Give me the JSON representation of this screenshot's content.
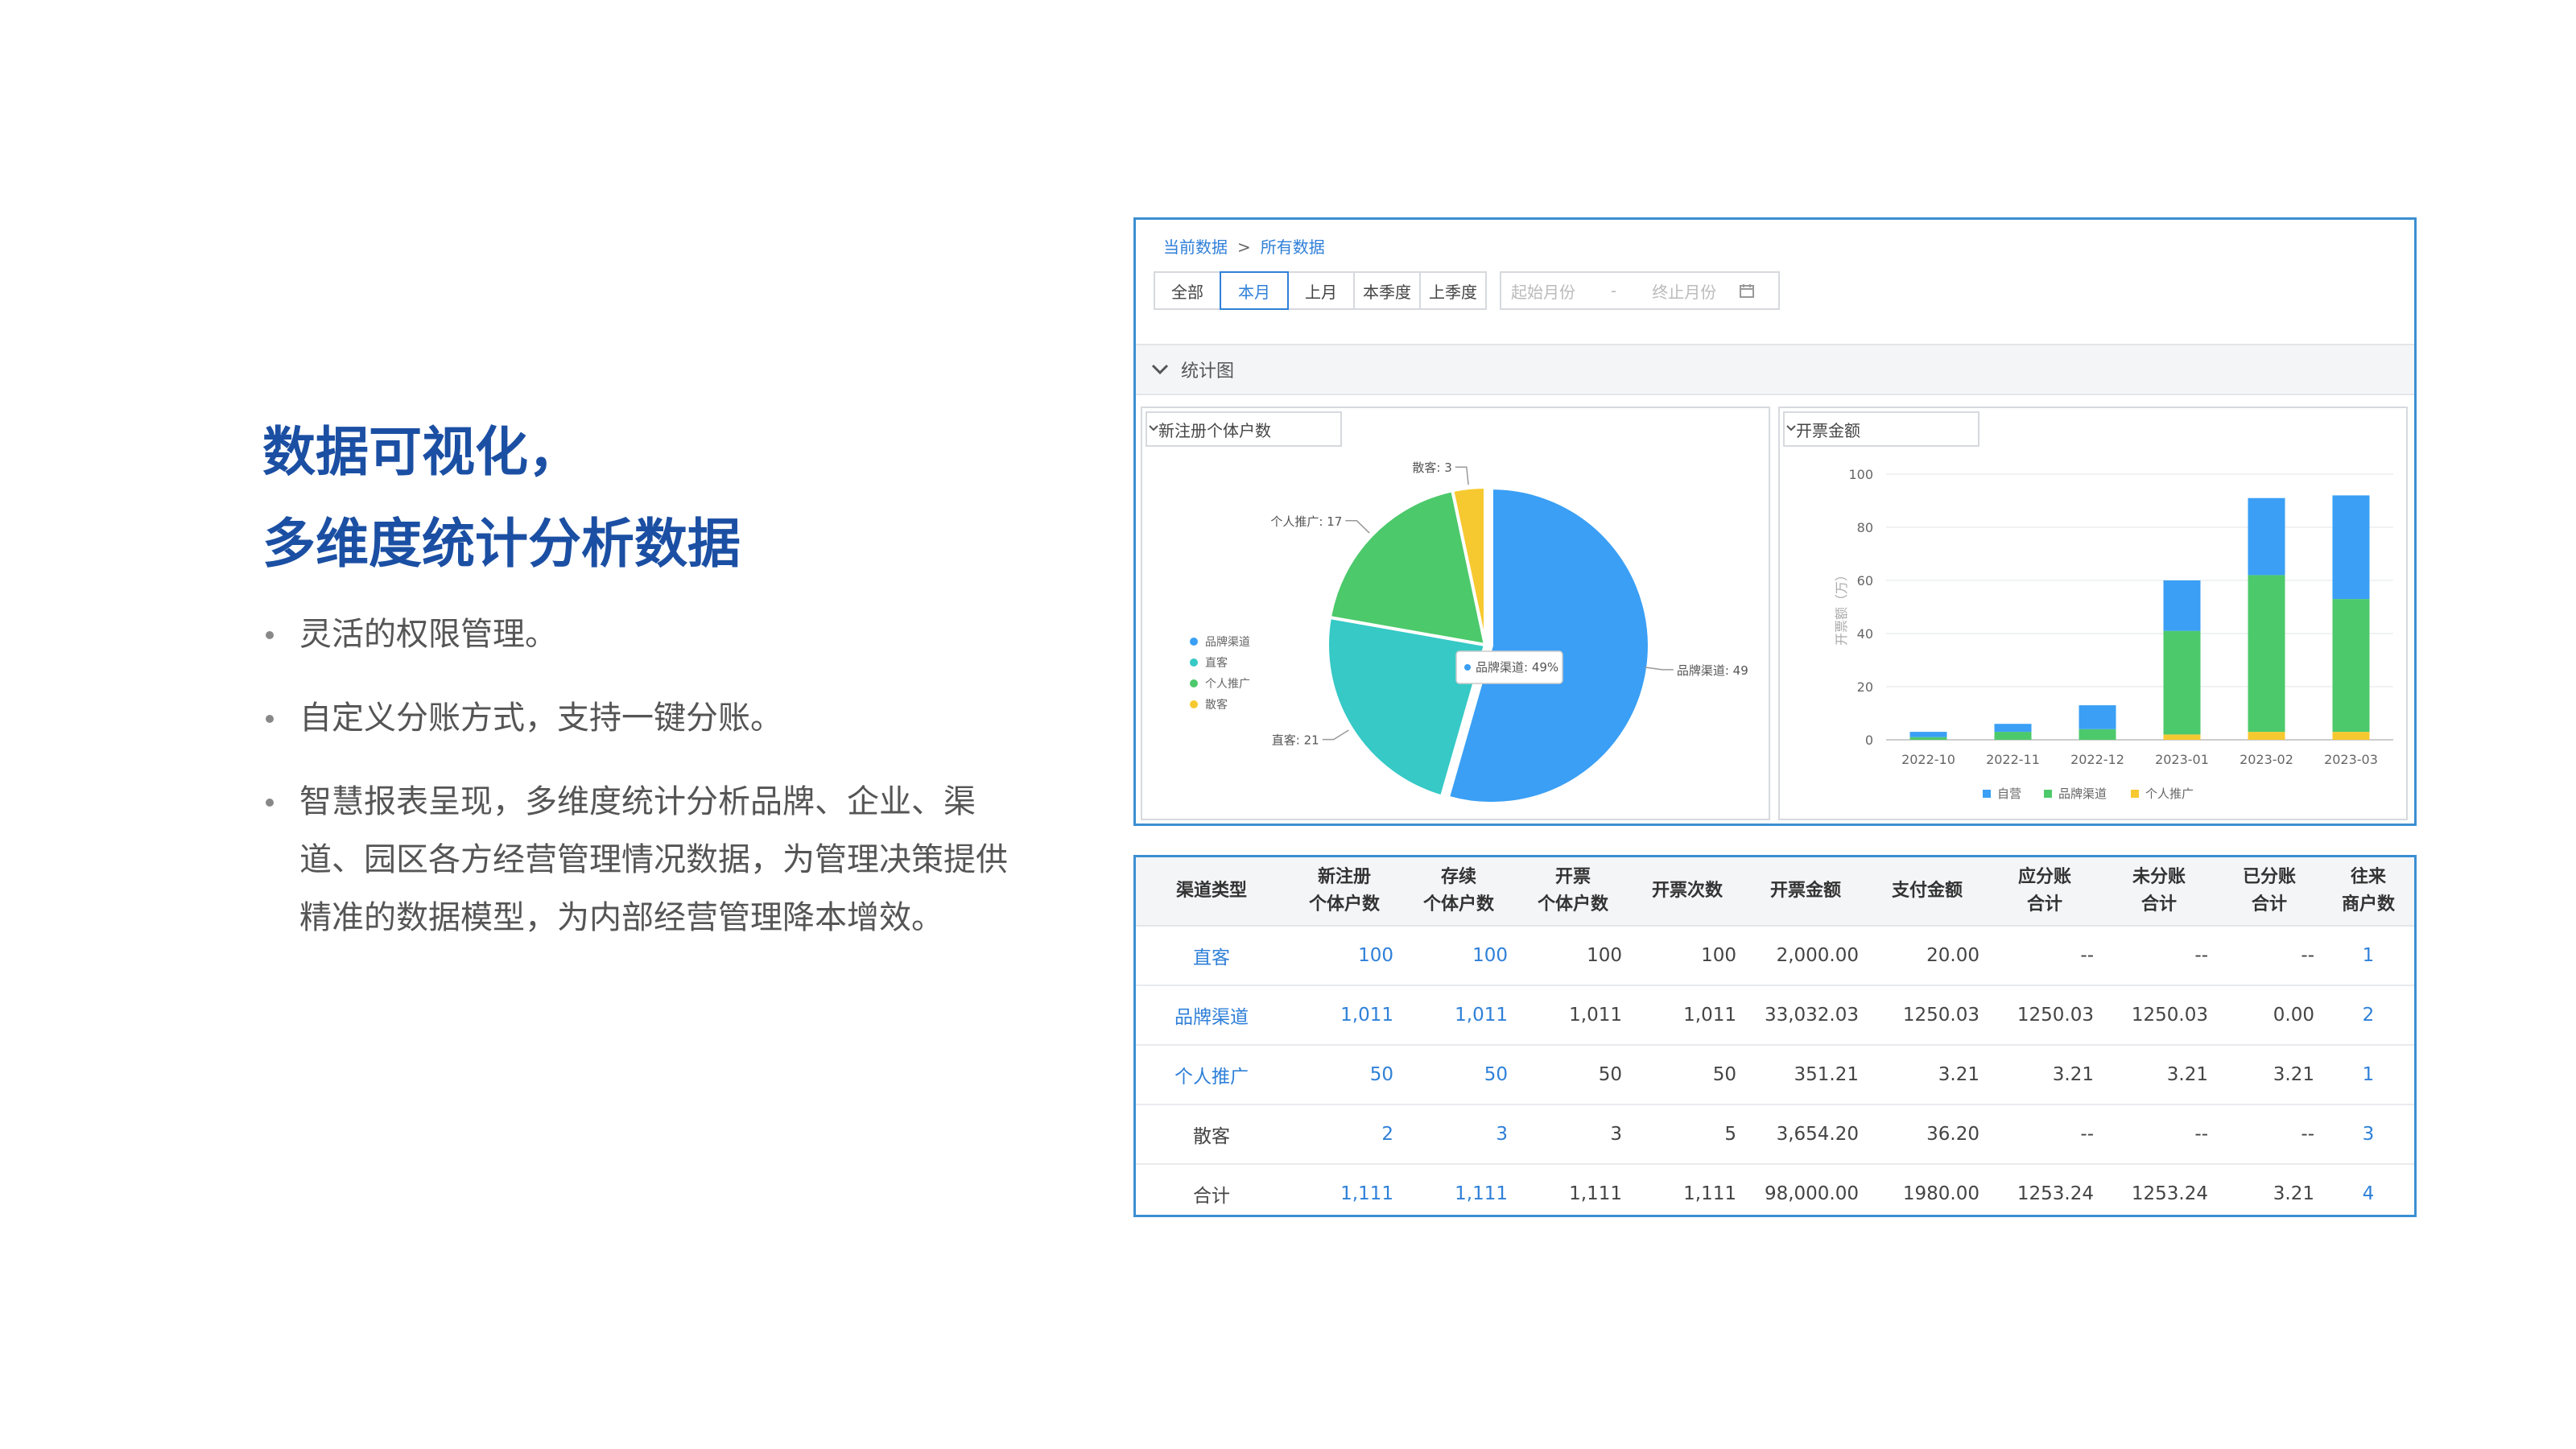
{
  "left": {
    "headline_lines": [
      "数据可视化，",
      "多维度统计分析数据"
    ],
    "bullets": [
      "灵活的权限管理。",
      "自定义分账方式，支持一键分账。",
      "智慧报表呈现，多维度统计分析品牌、企业、渠道、园区各方经营管理情况数据，为管理决策提供精准的数据模型，为内部经营管理降本增效。"
    ]
  },
  "dashboard": {
    "breadcrumb": {
      "current": "当前数据",
      "separator": ">",
      "all": "所有数据"
    },
    "filters": [
      "全部",
      "本月",
      "上月",
      "本季度",
      "上季度"
    ],
    "active_filter": "本月",
    "date_range": {
      "start_placeholder": "起始月份",
      "separator": "-",
      "end_placeholder": "终止月份"
    },
    "section_title": "统计图",
    "pie_select": "新注册个体户数",
    "bar_select": "开票金额",
    "colors": {
      "blue": "#3a9ff5",
      "teal": "#36c9c6",
      "green": "#4cc96b",
      "yellow": "#f7c930",
      "accent": "#2f80d8"
    }
  },
  "chart_data": [
    {
      "type": "pie",
      "categories": [
        "品牌渠道",
        "直客",
        "个人推广",
        "散客"
      ],
      "values": [
        49,
        21,
        17,
        3
      ],
      "labels": [
        "品牌渠道: 49",
        "直客: 21",
        "个人推广: 17",
        "散客: 3"
      ],
      "tooltip": "品牌渠道: 49%",
      "legend": [
        "品牌渠道",
        "直客",
        "个人推广",
        "散客"
      ],
      "legend_position": "left"
    },
    {
      "type": "bar",
      "stacked": true,
      "categories": [
        "2022-10",
        "2022-11",
        "2022-12",
        "2023-01",
        "2023-02",
        "2023-03"
      ],
      "series": [
        {
          "name": "自营",
          "values": [
            2,
            3,
            9,
            19,
            29,
            39
          ]
        },
        {
          "name": "品牌渠道",
          "values": [
            1,
            3,
            4,
            39,
            59,
            50
          ]
        },
        {
          "name": "个人推广",
          "values": [
            0,
            0,
            0,
            2,
            3,
            3
          ]
        }
      ],
      "ylabel": "开票额（万）",
      "yticks": [
        0,
        20,
        40,
        60,
        80,
        100
      ],
      "ylim": [
        0,
        100
      ],
      "legend_position": "bottom"
    }
  ],
  "table": {
    "headers": [
      [
        "渠道类型"
      ],
      [
        "新注册",
        "个体户数"
      ],
      [
        "存续",
        "个体户数"
      ],
      [
        "开票",
        "个体户数"
      ],
      [
        "开票次数"
      ],
      [
        "开票金额"
      ],
      [
        "支付金额"
      ],
      [
        "应分账",
        "合计"
      ],
      [
        "未分账",
        "合计"
      ],
      [
        "已分账",
        "合计"
      ],
      [
        "往来",
        "商户数"
      ]
    ],
    "rows": [
      [
        "直客",
        "100",
        "100",
        "100",
        "100",
        "2,000.00",
        "20.00",
        "--",
        "--",
        "--",
        "1"
      ],
      [
        "品牌渠道",
        "1,011",
        "1,011",
        "1,011",
        "1,011",
        "33,032.03",
        "1250.03",
        "1250.03",
        "1250.03",
        "0.00",
        "2"
      ],
      [
        "个人推广",
        "50",
        "50",
        "50",
        "50",
        "351.21",
        "3.21",
        "3.21",
        "3.21",
        "3.21",
        "1"
      ],
      [
        "散客",
        "2",
        "3",
        "3",
        "5",
        "3,654.20",
        "36.20",
        "--",
        "--",
        "--",
        "3"
      ],
      [
        "合计",
        "1,111",
        "1,111",
        "1,111",
        "1,111",
        "98,000.00",
        "1980.00",
        "1253.24",
        "1253.24",
        "3.21",
        "4"
      ]
    ]
  }
}
